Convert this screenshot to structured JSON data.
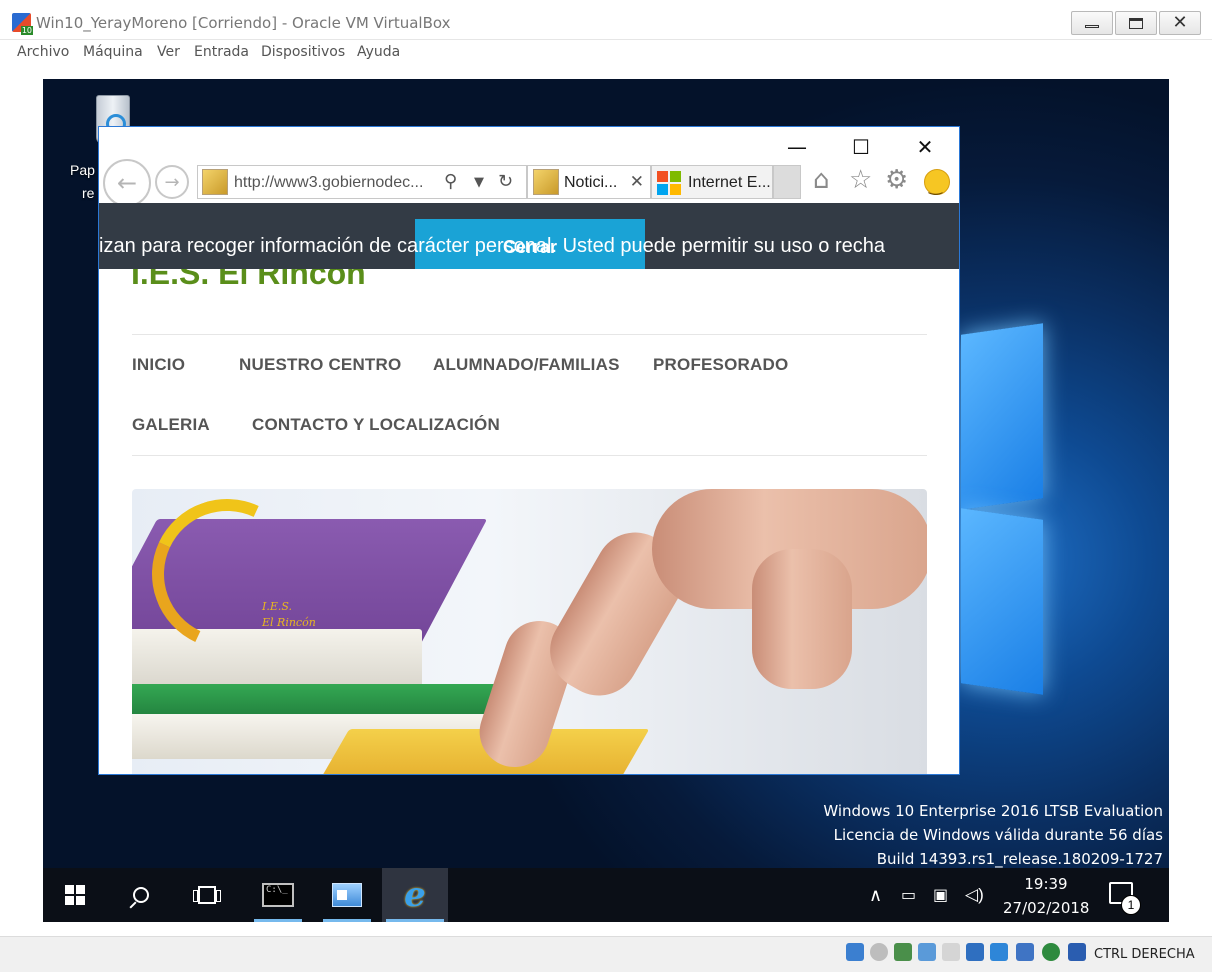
{
  "vbox": {
    "title": "Win10_YerayMoreno [Corriendo] - Oracle VM VirtualBox",
    "app_icon_badge": "10",
    "menu": [
      "Archivo",
      "Máquina",
      "Ver",
      "Entrada",
      "Dispositivos",
      "Ayuda"
    ],
    "status_host_key": "CTRL DERECHA"
  },
  "desktop": {
    "recycle_label_line1": "Pap",
    "recycle_label_line2": "re",
    "watermark": [
      "Windows 10 Enterprise 2016 LTSB Evaluation",
      "Licencia de Windows válida durante 56 días",
      "Build 14393.rs1_release.180209-1727"
    ]
  },
  "taskbar": {
    "time": "19:39",
    "date": "27/02/2018",
    "notification_count": "1"
  },
  "ie": {
    "address": "http://www3.gobiernodec...",
    "tabs": [
      {
        "label": "Notici...",
        "active": true
      },
      {
        "label": "Internet E...",
        "active": false
      }
    ]
  },
  "site": {
    "cookie_text": "izan para recoger información de carácter personal. Usted puede permitir su uso o recha",
    "cookie_button": "Cerrar",
    "title": "I.E.S. El Rincón",
    "nav": [
      "INICIO",
      "NUESTRO CENTRO",
      "ALUMNADO/FAMILIAS",
      "PROFESORADO",
      "GALERIA",
      "CONTACTO Y LOCALIZACIÓN"
    ],
    "hero_logo_text": [
      "I.E.S.",
      "El Rincón"
    ]
  },
  "colors": {
    "site_title": "#5a8e1a",
    "cookie_bar": "#333b45",
    "cookie_button": "#1aa3d6",
    "ie_border": "#2b78d6",
    "taskbar": "#0b0f17"
  }
}
